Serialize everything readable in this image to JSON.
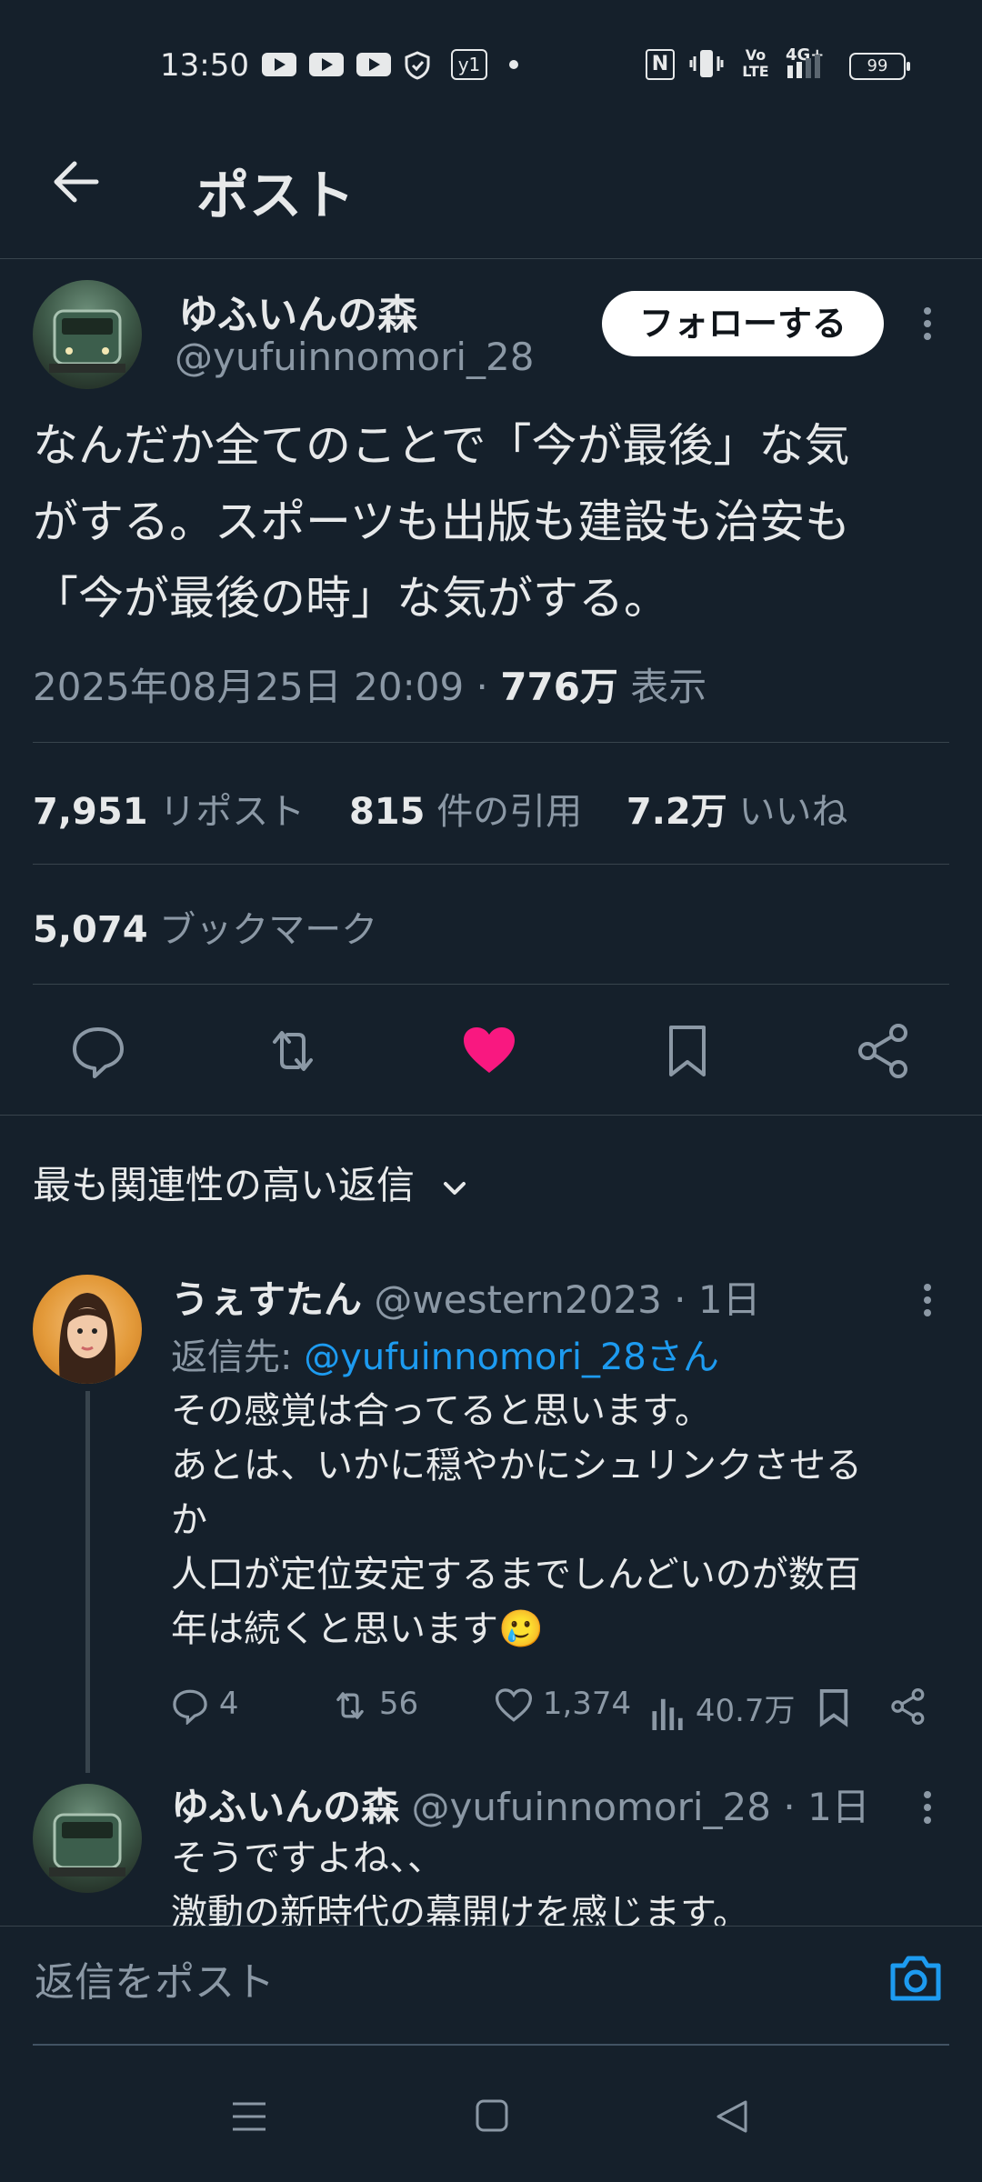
{
  "status_bar": {
    "time": "13:50",
    "vpn_label": "y1",
    "nfc_label": "N",
    "volte_top": "Vo",
    "volte_bottom": "LTE",
    "network": "4G+",
    "battery": "99"
  },
  "header": {
    "title": "ポスト"
  },
  "post": {
    "display_name": "ゆふいんの森",
    "handle": "@yufuinnomori_28",
    "follow_label": "フォローする",
    "text": "なんだか全てのことで「今が最後」な気\nがする。スポーツも出版も建設も治安も\n「今が最後の時」な気がする。",
    "timestamp": "2025年08月25日 20:09",
    "separator": "·",
    "views_value": "776万",
    "views_label": "表示",
    "reposts_value": "7,951",
    "reposts_label": "リポスト",
    "quotes_value": "815",
    "quotes_label": "件の引用",
    "likes_value": "7.2万",
    "likes_label": "いいね",
    "bookmarks_value": "5,074",
    "bookmarks_label": "ブックマーク"
  },
  "sort": {
    "label": "最も関連性の高い返信"
  },
  "replies": [
    {
      "display_name": "うぇすたん",
      "handle": "@western2023",
      "time": "· 1日",
      "reply_to_prefix": "返信先: ",
      "reply_to_handle": "@yufuinnomoriさん",
      "reply_to_handle_full": "@yufuinnomori_28さん",
      "text": "その感覚は合ってると思います。\nあとは、いかに穏やかにシュリンクさせる\nか\n人口が定位安定するまでしんどいのが数百\n年は続くと思います🥲",
      "replies_count": "4",
      "reposts_count": "56",
      "likes_count": "1,374",
      "views_count": "40.7万"
    },
    {
      "display_name": "ゆふいんの森",
      "handle": "@yufuinnomori_28",
      "time": "· 1日",
      "text": "そうですよね、、\n激動の新時代の幕開けを感じます。"
    }
  ],
  "compose": {
    "placeholder": "返信をポスト"
  },
  "colors": {
    "background": "#15202b",
    "like": "#f91880",
    "link": "#1d9bf0",
    "muted": "#8b98a5"
  }
}
